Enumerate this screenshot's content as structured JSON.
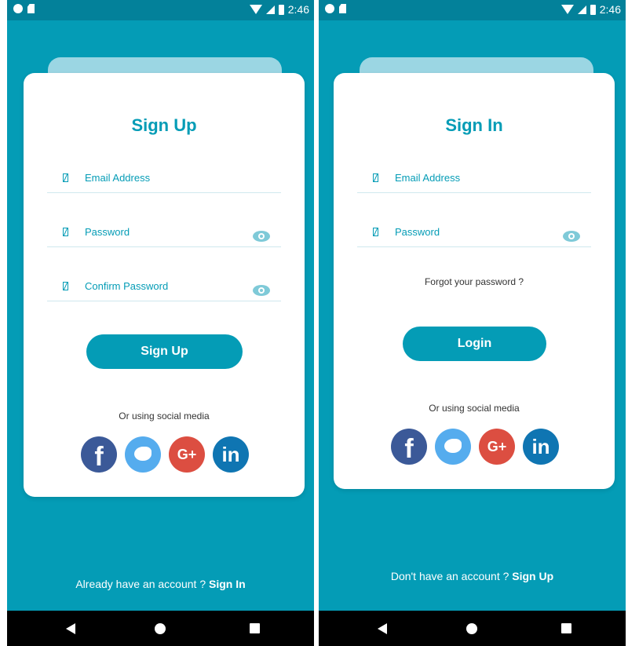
{
  "left_screen": {
    "status_time": "2:46",
    "title": "Sign Up",
    "fields": [
      {
        "label": "Email Address"
      },
      {
        "label": "Password"
      },
      {
        "label": "Confirm Password"
      }
    ],
    "button_label": "Sign Up",
    "social_label": "Or using social media",
    "footer_prefix": "Already have an account ?",
    "footer_link": "Sign In"
  },
  "right_screen": {
    "status_time": "2:46",
    "title": "Sign In",
    "fields": [
      {
        "label": "Email Address"
      },
      {
        "label": "Password"
      }
    ],
    "forgot_label": "Forgot your password ?",
    "button_label": "Login",
    "social_label": "Or using social media",
    "footer_prefix": "Don't have an account ?",
    "footer_link": "Sign Up"
  },
  "social": {
    "facebook": "f",
    "google_plus": "G+",
    "linkedin": "in"
  },
  "colors": {
    "primary": "#049cb6",
    "status_bar": "#03819a",
    "card_tab": "#9bd6e3"
  },
  "icons": {
    "field": "field-icon",
    "password_toggle": "eye-icon"
  }
}
